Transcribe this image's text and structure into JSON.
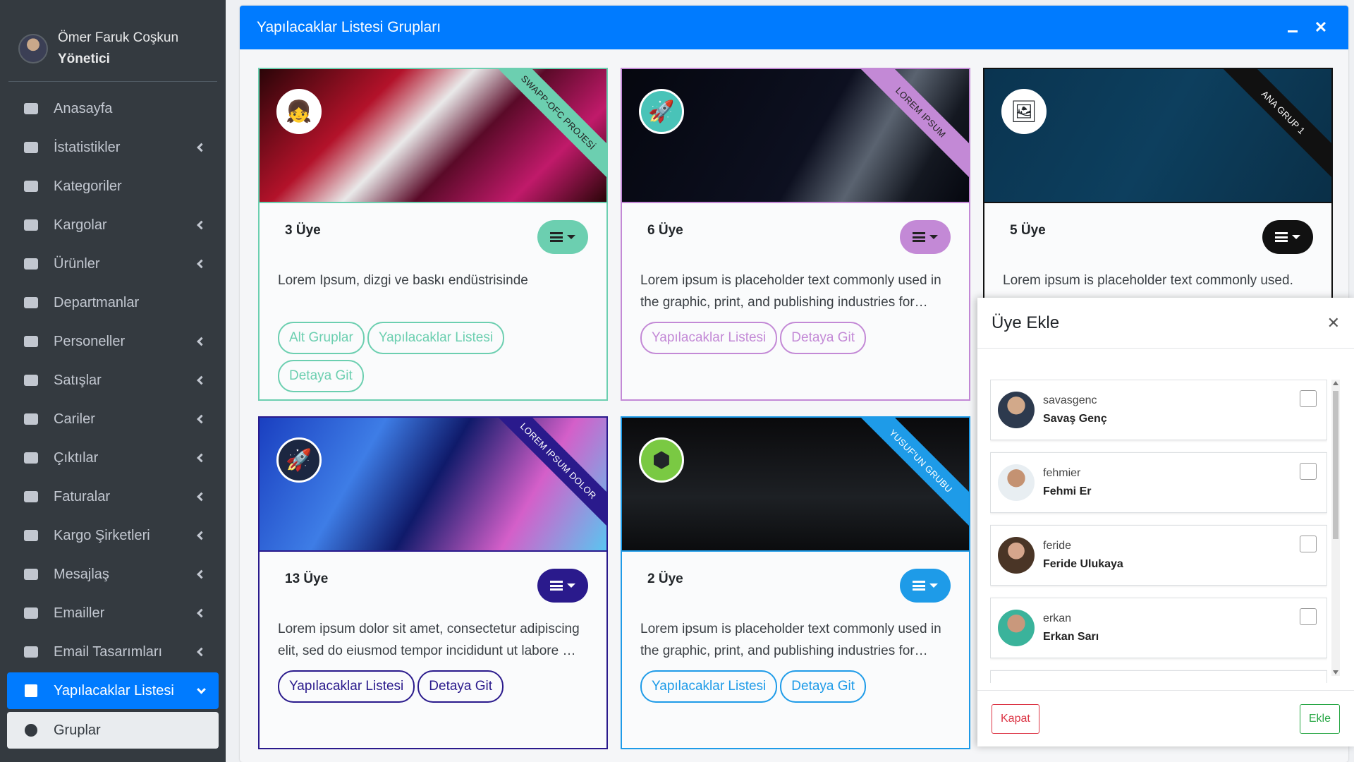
{
  "user": {
    "name": "Ömer Faruk Coşkun",
    "role": "Yönetici"
  },
  "sidebar": {
    "items": [
      {
        "label": "Anasayfa",
        "icon": "dashboard-icon",
        "chevron": false
      },
      {
        "label": "İstatistikler",
        "icon": "chart-area-icon",
        "chevron": true
      },
      {
        "label": "Kategoriler",
        "icon": "list-icon",
        "chevron": false
      },
      {
        "label": "Kargolar",
        "icon": "truck-icon",
        "chevron": true
      },
      {
        "label": "Ürünler",
        "icon": "mobile-icon",
        "chevron": true
      },
      {
        "label": "Departmanlar",
        "icon": "chalkboard-icon",
        "chevron": false
      },
      {
        "label": "Personeller",
        "icon": "users-icon",
        "chevron": true
      },
      {
        "label": "Satışlar",
        "icon": "money-icon",
        "chevron": true
      },
      {
        "label": "Cariler",
        "icon": "users-cog-icon",
        "chevron": true
      },
      {
        "label": "Çıktılar",
        "icon": "file-pdf-icon",
        "chevron": true
      },
      {
        "label": "Faturalar",
        "icon": "receipt-icon",
        "chevron": true
      },
      {
        "label": "Kargo Şirketleri",
        "icon": "truck-moving-icon",
        "chevron": true
      },
      {
        "label": "Mesajlaş",
        "icon": "comment-icon",
        "chevron": true
      },
      {
        "label": "Emailler",
        "icon": "envelope-icon",
        "chevron": true
      },
      {
        "label": "Email Tasarımları",
        "icon": "mail-bulk-icon",
        "chevron": true
      },
      {
        "label": "Yapılacaklar Listesi",
        "icon": "check-square-icon",
        "chevron": true,
        "active": true
      },
      {
        "label": "Gruplar",
        "icon": "circle-icon",
        "chevron": false,
        "sub": true
      }
    ]
  },
  "panel": {
    "title": "Yapılacaklar Listesi Grupları"
  },
  "groups": [
    {
      "ribbon": "SWAPP-OFC PROJESİ",
      "count": "3 Üye",
      "desc": "Lorem Ipsum, dizgi ve baskı endüstrisinde",
      "color": "#6ccfb0",
      "ribbon_color": "#6ccfb0",
      "buttons": [
        "Alt Gruplar",
        "Yapılacaklar Listesi",
        "Detaya Git"
      ],
      "logo": "user-avatar-icon"
    },
    {
      "ribbon": "LOREM IPSUM",
      "count": "6 Üye",
      "desc": "Lorem ipsum is placeholder text commonly used in the graphic, print, and publishing industries for…",
      "color": "#c389d6",
      "ribbon_color": "#c389d6",
      "buttons": [
        "Yapılacaklar Listesi",
        "Detaya Git"
      ],
      "logo": "rocket-icon"
    },
    {
      "ribbon": "ANA GRUP 1",
      "count": "5 Üye",
      "desc": "Lorem ipsum is placeholder text commonly used.",
      "color": "#111111",
      "ribbon_color": "#111111",
      "buttons": [],
      "logo": "image-icon"
    },
    {
      "ribbon": "LOREM IPSUM DOLOR",
      "count": "13 Üye",
      "desc": "Lorem ipsum dolor sit amet, consectetur adipiscing elit, sed do eiusmod tempor incididunt ut labore …",
      "color": "#2a1a8c",
      "ribbon_color": "#2a1a8c",
      "buttons": [
        "Yapılacaklar Listesi",
        "Detaya Git"
      ],
      "logo": "rocket-icon"
    },
    {
      "ribbon": "YUSUF'UN GRUBU",
      "count": "2 Üye",
      "desc": "Lorem ipsum is placeholder text commonly used in the graphic, print, and publishing industries for…",
      "color": "#1e9be8",
      "ribbon_color": "#1e9be8",
      "buttons": [
        "Yapılacaklar Listesi",
        "Detaya Git"
      ],
      "logo": "cube-icon"
    }
  ],
  "modal": {
    "title": "Üye Ekle",
    "close_label": "Kapat",
    "add_label": "Ekle",
    "members": [
      {
        "username": "savasgenc",
        "name": "Savaş Genç"
      },
      {
        "username": "fehmier",
        "name": "Fehmi Er"
      },
      {
        "username": "feride",
        "name": "Feride Ulukaya"
      },
      {
        "username": "erkan",
        "name": "Erkan Sarı"
      }
    ]
  },
  "colors": {
    "primary": "#007bff",
    "sidebar": "#343a40",
    "danger": "#dc3545",
    "success": "#28a745"
  }
}
